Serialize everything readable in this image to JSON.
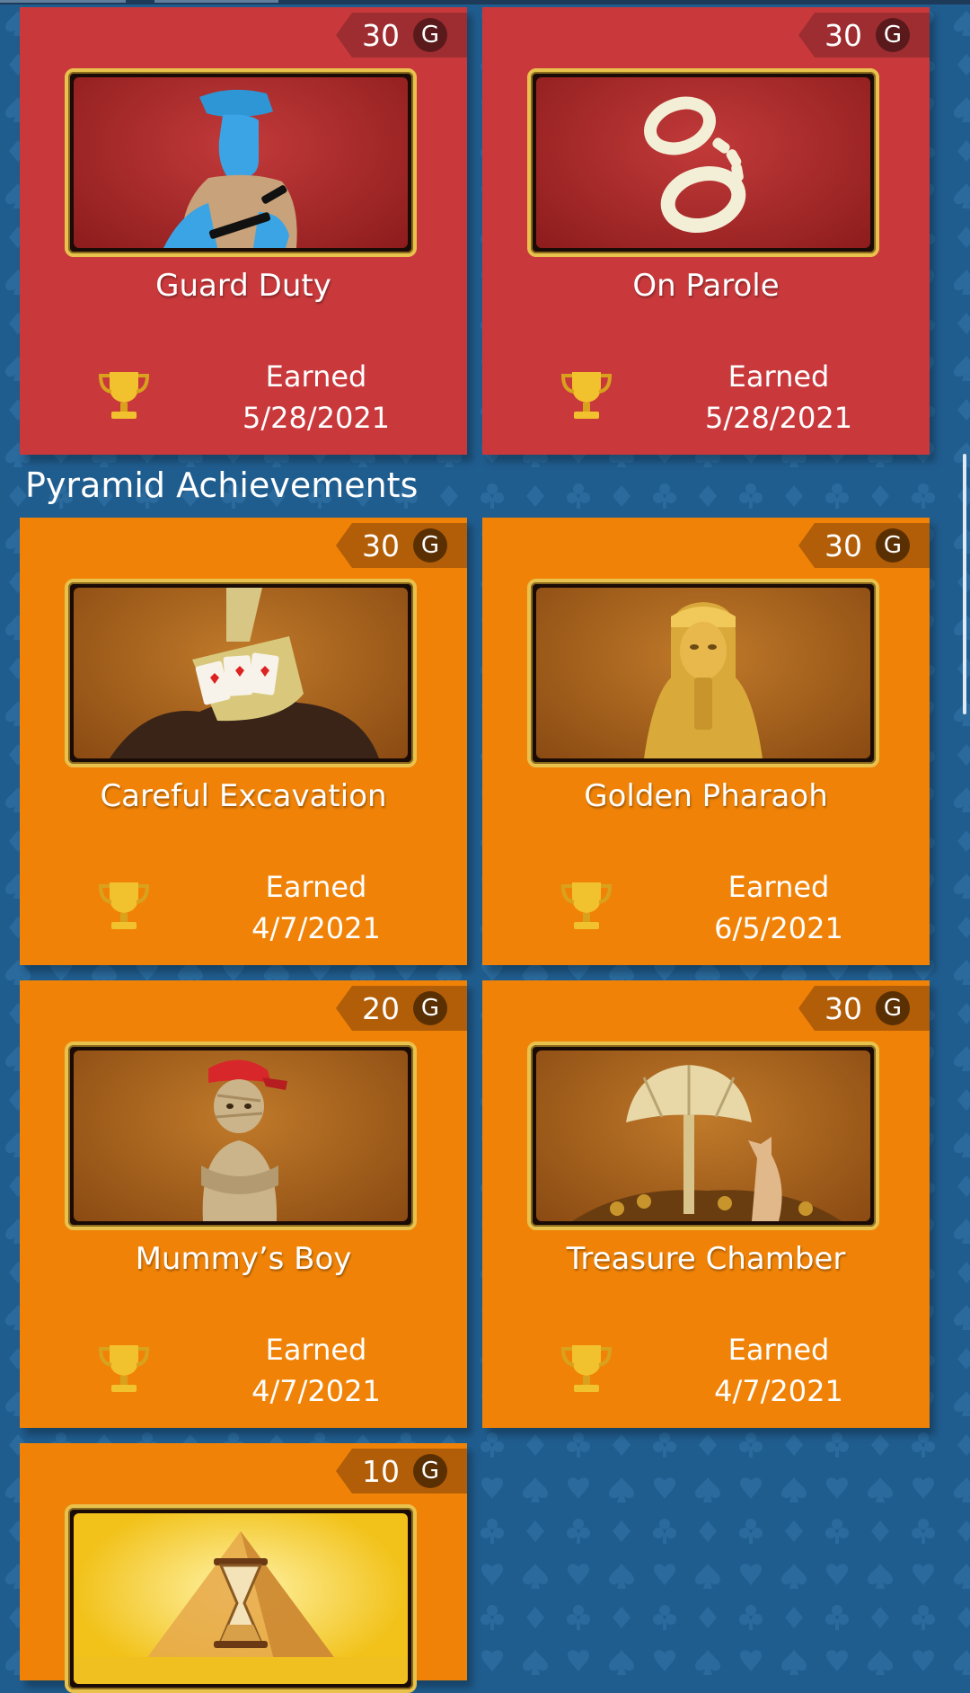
{
  "colors": {
    "background": "#205d8f",
    "prison_card": "#c9393c",
    "pyramid_card": "#f08307",
    "frame_gold": "#e9c24d"
  },
  "section": {
    "heading": "Pyramid Achievements"
  },
  "achievements": [
    {
      "title": "Guard Duty",
      "points": "30",
      "g": "G",
      "status": "Earned",
      "date": "5/28/2021",
      "icon": "guard-icon",
      "theme": "red"
    },
    {
      "title": "On Parole",
      "points": "30",
      "g": "G",
      "status": "Earned",
      "date": "5/28/2021",
      "icon": "handcuffs-icon",
      "theme": "red"
    },
    {
      "title": "Careful Excavation",
      "points": "30",
      "g": "G",
      "status": "Earned",
      "date": "4/7/2021",
      "icon": "excavation-cards-icon",
      "theme": "orange"
    },
    {
      "title": "Golden Pharaoh",
      "points": "30",
      "g": "G",
      "status": "Earned",
      "date": "6/5/2021",
      "icon": "pharaoh-icon",
      "theme": "orange"
    },
    {
      "title": "Mummy’s Boy",
      "points": "20",
      "g": "G",
      "status": "Earned",
      "date": "4/7/2021",
      "icon": "mummy-icon",
      "theme": "orange"
    },
    {
      "title": "Treasure Chamber",
      "points": "30",
      "g": "G",
      "status": "Earned",
      "date": "4/7/2021",
      "icon": "treasure-fan-icon",
      "theme": "orange"
    },
    {
      "title": "",
      "points": "10",
      "g": "G",
      "status": "",
      "date": "",
      "icon": "hourglass-pyramid-icon",
      "theme": "orange"
    }
  ]
}
